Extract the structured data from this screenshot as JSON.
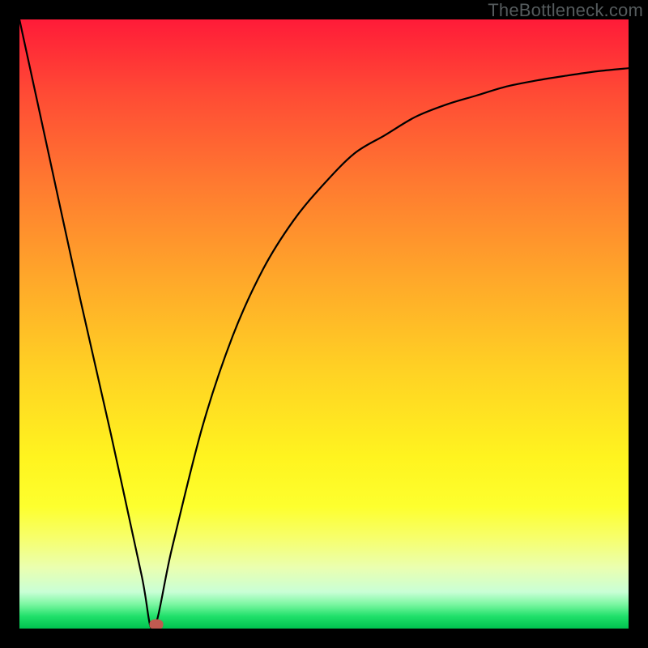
{
  "watermark": "TheBottleneck.com",
  "chart_data": {
    "type": "line",
    "title": "",
    "xlabel": "",
    "ylabel": "",
    "xlim": [
      0,
      100
    ],
    "ylim": [
      0,
      100
    ],
    "grid": false,
    "legend": false,
    "series": [
      {
        "name": "bottleneck-curve",
        "x": [
          0,
          5,
          10,
          15,
          20,
          22,
          25,
          30,
          35,
          40,
          45,
          50,
          55,
          60,
          65,
          70,
          75,
          80,
          85,
          90,
          95,
          100
        ],
        "values": [
          100,
          77,
          54,
          32,
          9,
          0,
          13,
          33,
          48,
          59,
          67,
          73,
          78,
          81,
          84,
          86,
          87.5,
          89,
          90,
          90.8,
          91.5,
          92
        ]
      }
    ],
    "marker": {
      "x": 22.5,
      "y": 0.7,
      "color": "#c05a50"
    },
    "background_gradient": {
      "top": "#ff1b38",
      "bottom": "#00c24f",
      "stops": [
        "red",
        "orange",
        "yellow",
        "green"
      ]
    }
  }
}
